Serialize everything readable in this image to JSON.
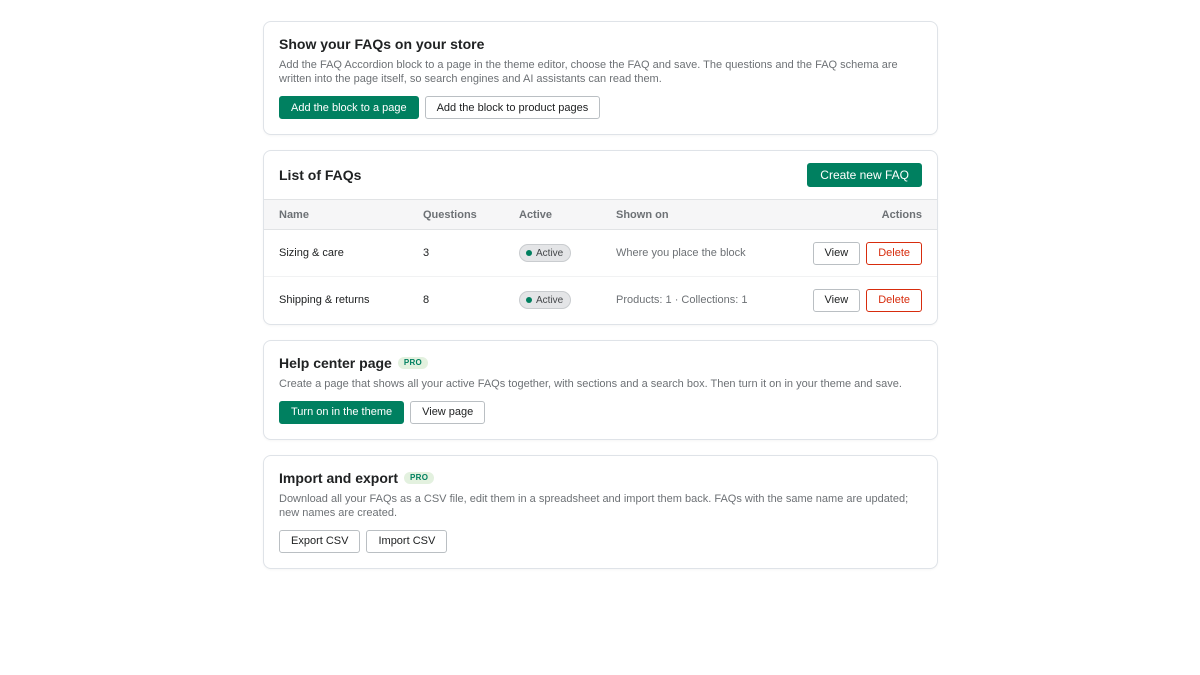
{
  "show_faqs": {
    "title": "Show your FAQs on your store",
    "description": "Add the FAQ Accordion block to a page in the theme editor, choose the FAQ and save. The questions and the FAQ schema are written into the page itself, so search engines and AI assistants can read them.",
    "add_page_label": "Add the block to a page",
    "add_product_label": "Add the block to product pages"
  },
  "faq_list": {
    "title": "List of FAQs",
    "create_label": "Create new FAQ",
    "columns": [
      "Name",
      "Questions",
      "Active",
      "Shown on",
      "Actions"
    ],
    "rows": [
      {
        "name": "Sizing & care",
        "questions": "3",
        "status": "Active",
        "shown_on": "Where you place the block",
        "view": "View",
        "delete": "Delete"
      },
      {
        "name": "Shipping & returns",
        "questions": "8",
        "status": "Active",
        "shown_on": "Products: 1 · Collections: 1",
        "view": "View",
        "delete": "Delete"
      }
    ]
  },
  "help_center": {
    "title": "Help center page",
    "badge": "PRO",
    "description": "Create a page that shows all your active FAQs together, with sections and a search box. Then turn it on in your theme and save.",
    "turn_on_label": "Turn on in the theme",
    "view_label": "View page"
  },
  "import_export": {
    "title": "Import and export",
    "badge": "PRO",
    "description": "Download all your FAQs as a CSV file, edit them in a spreadsheet and import them back. FAQs with the same name are updated; new names are created.",
    "export_label": "Export CSV",
    "import_label": "Import CSV"
  },
  "colors": {
    "primary": "#008060",
    "danger": "#d72c0d",
    "active_dot": "#007f5f"
  }
}
